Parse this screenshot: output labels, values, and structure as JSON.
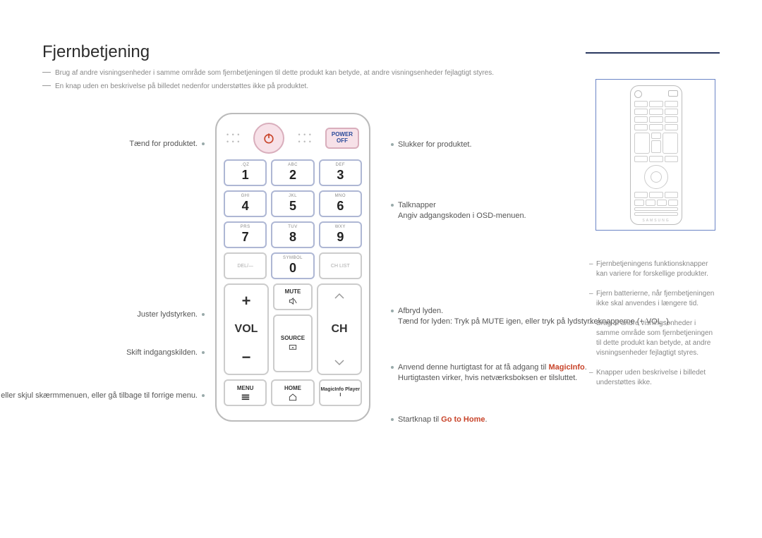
{
  "title": "Fjernbetjening",
  "notes": {
    "a": "Brug af andre visningsenheder i samme område som fjernbetjeningen til dette produkt kan betyde, at andre visningsenheder fejlagtigt styres.",
    "b": "En knap uden en beskrivelse på billedet nedenfor understøttes ikke på produktet."
  },
  "left": {
    "power_on": "Tænd for produktet.",
    "volume": "Juster lydstyrken.",
    "source": "Skift indgangskilden.",
    "menu": "Vis eller skjul skærmmenuen, eller gå tilbage til forrige menu."
  },
  "right": {
    "power_off": "Slukker for produktet.",
    "num1": "Talknapper",
    "num2": "Angiv adgangskoden i OSD-menuen.",
    "mute1": "Afbryd lyden.",
    "mute2": "Tænd for lyden: Tryk på MUTE igen, eller tryk på lydstyrkeknapperne (+  VOL  -).",
    "magic1": "Anvend denne hurtigtast for at få adgang til ",
    "magic_hl": "MagicInfo",
    "magic2": "Hurtigtasten virker, hvis netværksboksen er tilsluttet.",
    "home": "Startknap til ",
    "home_hl": "Go to Home"
  },
  "remote": {
    "power": "POWER",
    "off": "OFF",
    "keys": [
      {
        "sub": ".QZ",
        "num": "1"
      },
      {
        "sub": "ABC",
        "num": "2"
      },
      {
        "sub": "DEF",
        "num": "3"
      },
      {
        "sub": "GHI",
        "num": "4"
      },
      {
        "sub": "JKL",
        "num": "5"
      },
      {
        "sub": "MNO",
        "num": "6"
      },
      {
        "sub": "PRS",
        "num": "7"
      },
      {
        "sub": "TUV",
        "num": "8"
      },
      {
        "sub": "WXY",
        "num": "9"
      }
    ],
    "del": "DEL/—",
    "sym": "SYMBOL",
    "zero": "0",
    "chlist": "CH LIST",
    "vol": "VOL",
    "ch": "CH",
    "mute": "MUTE",
    "source": "SOURCE",
    "menu": "MENU",
    "home_btn": "HOME",
    "magicinfo": "MagicInfo Player I"
  },
  "side": {
    "brand": "SAMSUNG",
    "n1": "Fjernbetjeningens funktionsknapper kan variere for forskellige produkter.",
    "n2": "Fjern batterierne, når fjernbetjeningen ikke skal anvendes i længere tid.",
    "n3": "Brug af andre visningsenheder i samme område som fjernbetjeningen til dette produkt kan betyde, at andre visningsenheder fejlagtigt styres.",
    "n4": "Knapper uden beskrivelse i billedet understøttes ikke."
  }
}
